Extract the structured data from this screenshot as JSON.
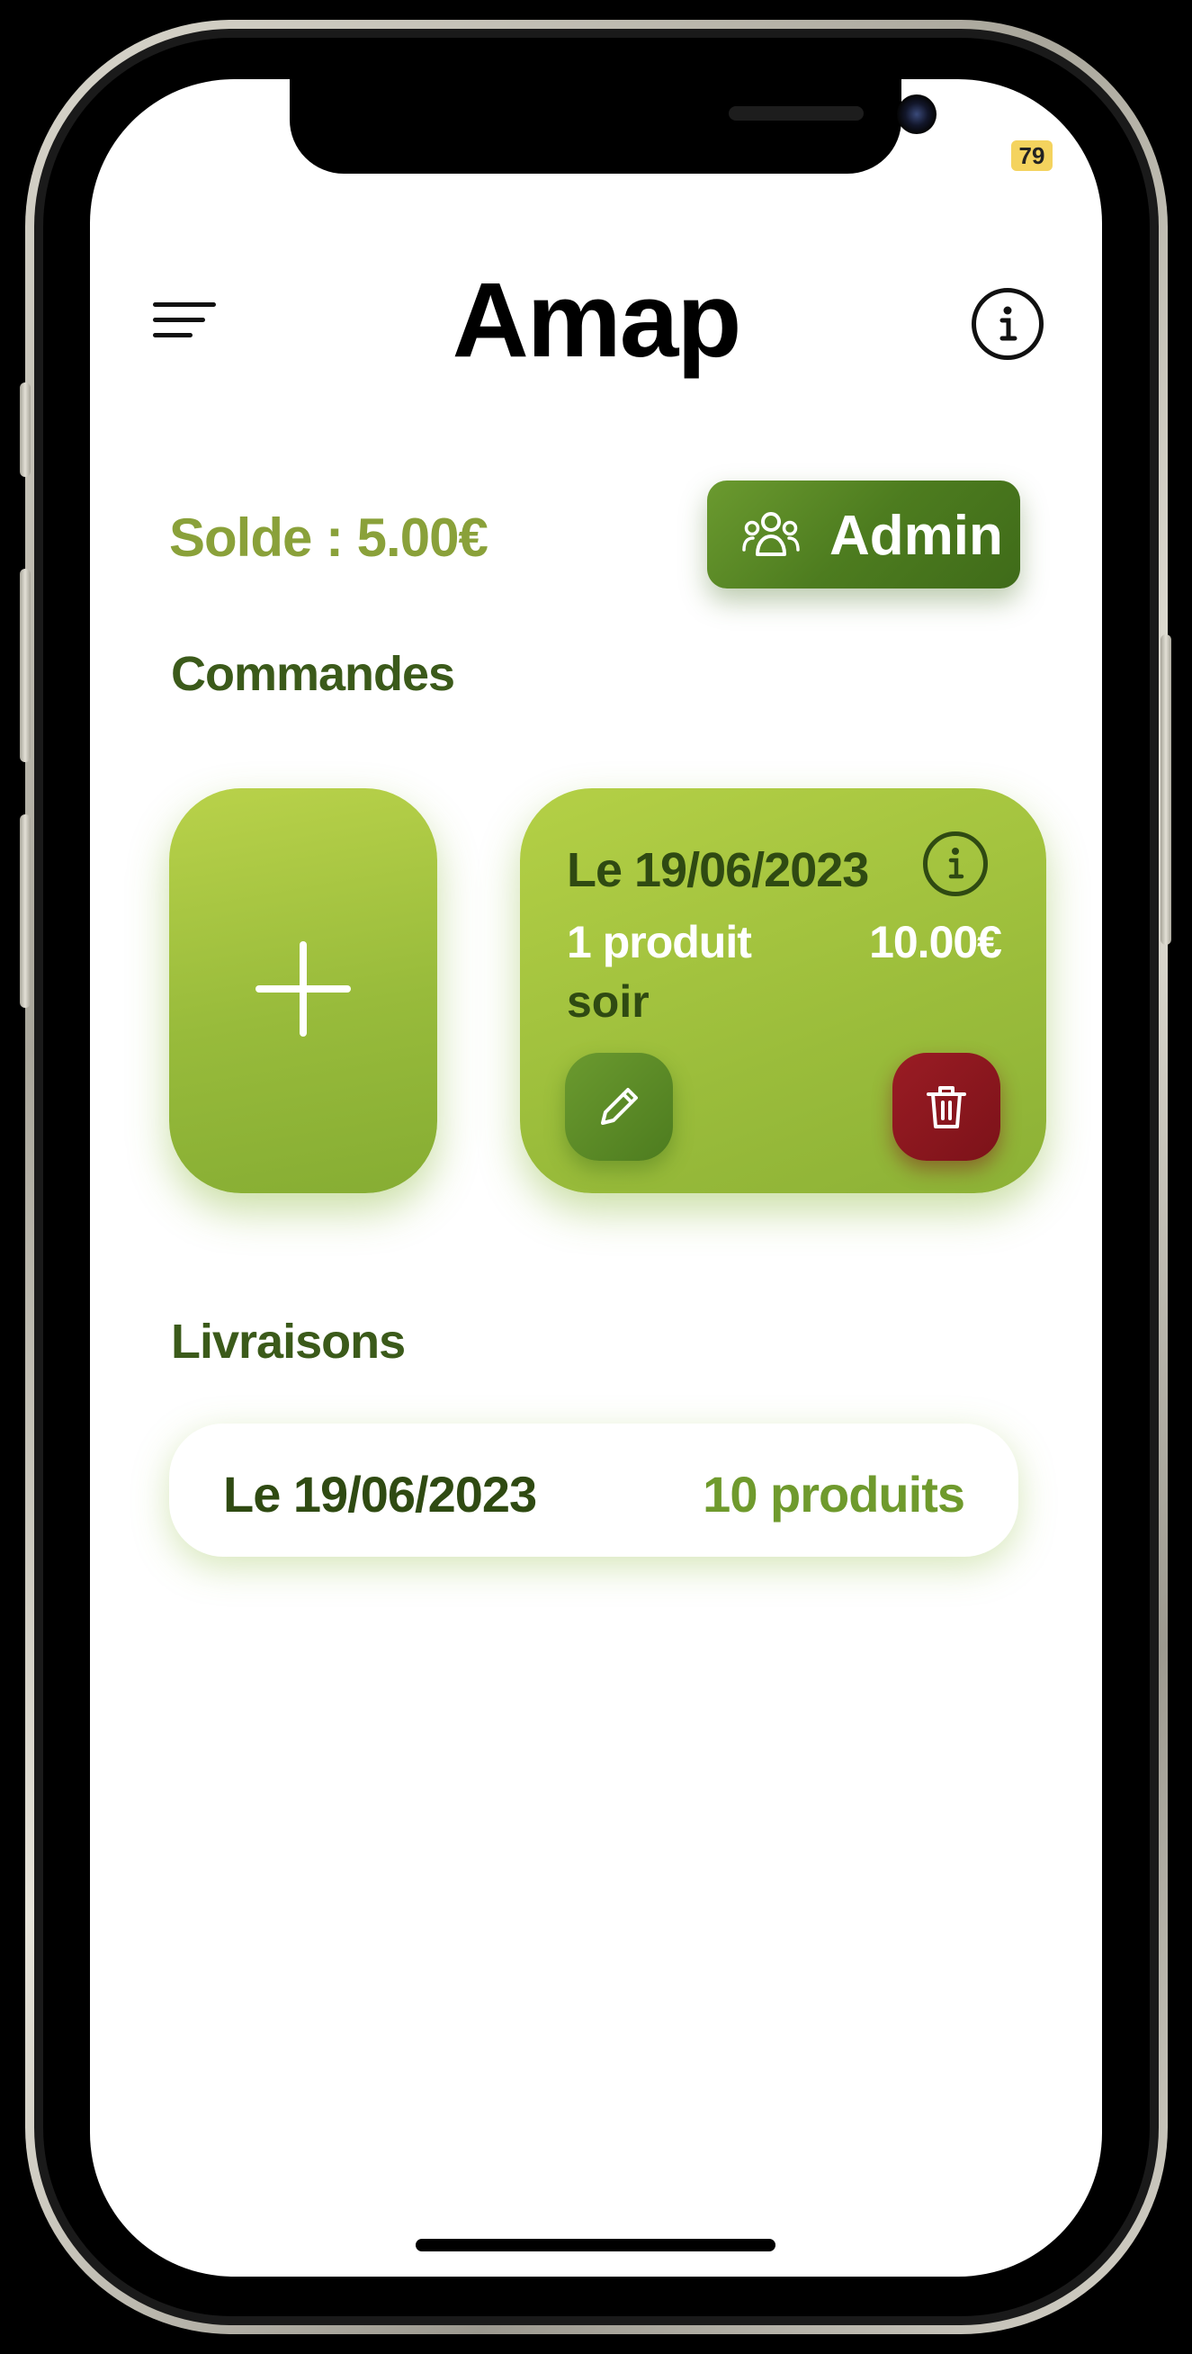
{
  "status": {
    "badge": "79"
  },
  "header": {
    "title": "Amap",
    "menu_icon": "hamburger-menu-icon",
    "info_icon": "info-icon"
  },
  "balance": {
    "label": "Solde : 5.00€"
  },
  "admin_button": {
    "label": "Admin",
    "icon": "users-group-icon"
  },
  "orders": {
    "section_title": "Commandes",
    "add_icon": "plus-icon",
    "items": [
      {
        "date": "Le 19/06/2023",
        "count": "1 produit",
        "price": "10.00€",
        "slot": "soir",
        "edit_icon": "pencil-icon",
        "delete_icon": "trash-icon"
      }
    ]
  },
  "deliveries": {
    "section_title": "Livraisons",
    "items": [
      {
        "date": "Le 19/06/2023",
        "count": "10 produits"
      }
    ]
  },
  "colors": {
    "accent_green": "#8aa13a",
    "dark_green": "#3b5a1a",
    "button_green": "#4d7c1f",
    "danger_red": "#8c1720",
    "card_green": "#9bbd3b"
  }
}
